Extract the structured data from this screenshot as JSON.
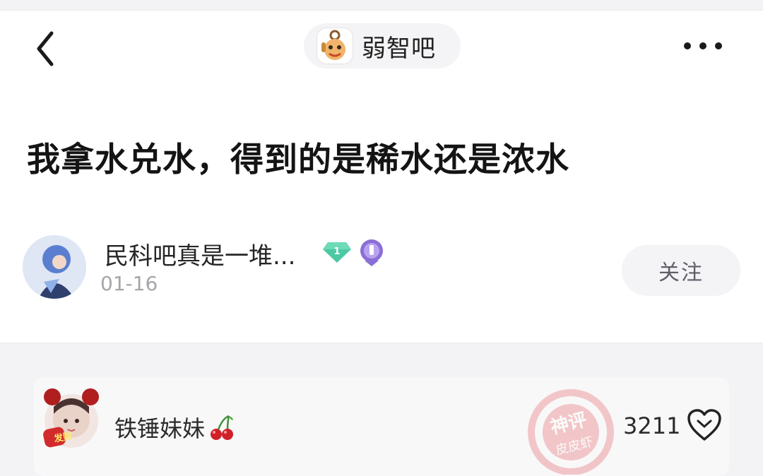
{
  "header": {
    "forum_name": "弱智吧",
    "back_icon": "chevron-left-icon",
    "more_icon": "more-dots-icon"
  },
  "post": {
    "title": "我拿水兑水，得到的是稀水还是浓水",
    "author": {
      "name": "民科吧真是一堆...",
      "level_badge": "1",
      "date": "01-16",
      "follow_label": "关注"
    }
  },
  "comment": {
    "username": "铁锤妹妹",
    "username_icon": "cherry-icon",
    "like_count": "3211",
    "like_icon": "heart-outline-icon",
    "watermark_text": "神评",
    "watermark_sub": "皮皮虾",
    "avatar_text": "发财"
  },
  "colors": {
    "badge_green": "#4cc9a4",
    "badge_purple": "#8a6fd6",
    "watermark_red": "#e0464e",
    "follow_bg": "#f4f4f7"
  }
}
